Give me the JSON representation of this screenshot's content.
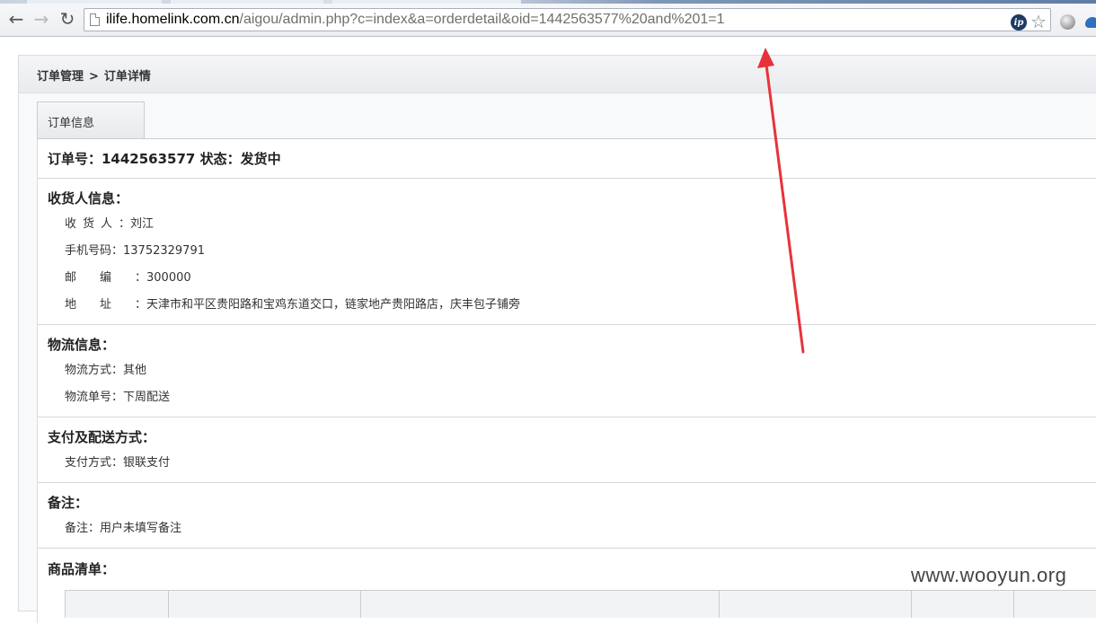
{
  "browser": {
    "url_host": "ilife.homelink.com.cn",
    "url_path": "/aigou/admin.php?c=index&a=orderdetail&oid=1442563577%20and%201=1",
    "ip_badge": "ip"
  },
  "breadcrumb": {
    "parent": "订单管理",
    "separator": ">",
    "current": "订单详情"
  },
  "tabs": {
    "order_info": "订单信息"
  },
  "order": {
    "heading": "订单号：1442563577 状态：发货中"
  },
  "recipient": {
    "title": "收货人信息：",
    "name_label": "收货人",
    "name_value": "：刘江",
    "phone_label": "手机号码",
    "phone_value": "：13752329791",
    "zip_label": "邮编",
    "zip_value": "：300000",
    "address_label": "地址",
    "address_value": "：天津市和平区贵阳路和宝鸡东道交口，链家地产贵阳路店，庆丰包子铺旁"
  },
  "logistics": {
    "title": "物流信息：",
    "method_label": "物流方式",
    "method_value": "：其他",
    "tracking_label": "物流单号",
    "tracking_value": "：下周配送"
  },
  "payment": {
    "title": "支付及配送方式：",
    "method_label": "支付方式",
    "method_value": "：银联支付"
  },
  "remark": {
    "title": "备注：",
    "label": "备注",
    "value": "：用户未填写备注"
  },
  "products": {
    "title": "商品清单："
  },
  "watermark": "www.wooyun.org",
  "colors": {
    "arrow": "#e8323a",
    "ip_badge": "#1d3c63"
  }
}
